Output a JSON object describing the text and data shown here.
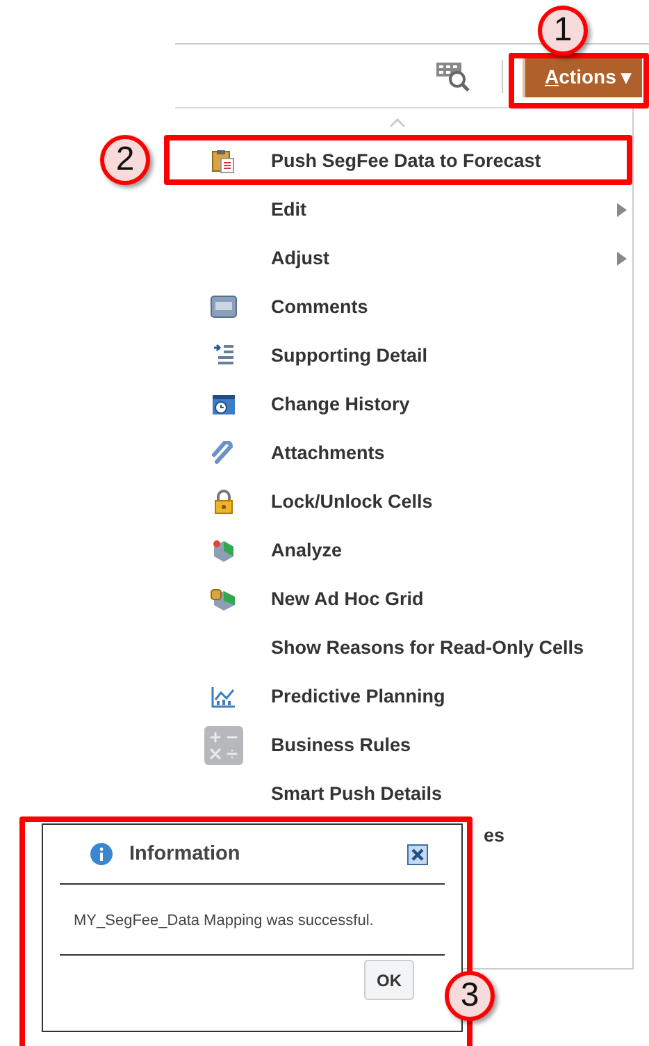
{
  "toolbar": {
    "actions_button": {
      "label": "Actions",
      "caret": "▾"
    }
  },
  "menu": {
    "items": [
      {
        "label": "Push SegFee Data to Forecast",
        "kind": "item",
        "submenu": false
      },
      {
        "label": "Edit",
        "kind": "item",
        "submenu": true
      },
      {
        "label": "Adjust",
        "kind": "item",
        "submenu": true
      },
      {
        "label": "Comments",
        "kind": "item",
        "submenu": false
      },
      {
        "label": "Supporting Detail",
        "kind": "item",
        "submenu": false
      },
      {
        "label": "Change History",
        "kind": "item",
        "submenu": false
      },
      {
        "label": "Attachments",
        "kind": "item",
        "submenu": false
      },
      {
        "label": "Lock/Unlock Cells",
        "kind": "item",
        "submenu": false
      },
      {
        "label": "Analyze",
        "kind": "item",
        "submenu": false
      },
      {
        "label": "New Ad Hoc Grid",
        "kind": "item",
        "submenu": false
      },
      {
        "label": "Show Reasons for Read-Only Cells",
        "kind": "item",
        "submenu": false
      },
      {
        "label": "Predictive Planning",
        "kind": "item",
        "submenu": false
      },
      {
        "label": "Business Rules",
        "kind": "item",
        "submenu": false
      },
      {
        "label": "Smart Push Details",
        "kind": "item",
        "submenu": false
      },
      {
        "label": "es",
        "kind": "partial",
        "submenu": false
      }
    ]
  },
  "dialog": {
    "title": "Information",
    "message": "MY_SegFee_Data Mapping was successful.",
    "button": "OK"
  },
  "callouts": [
    "1",
    "2",
    "3"
  ]
}
